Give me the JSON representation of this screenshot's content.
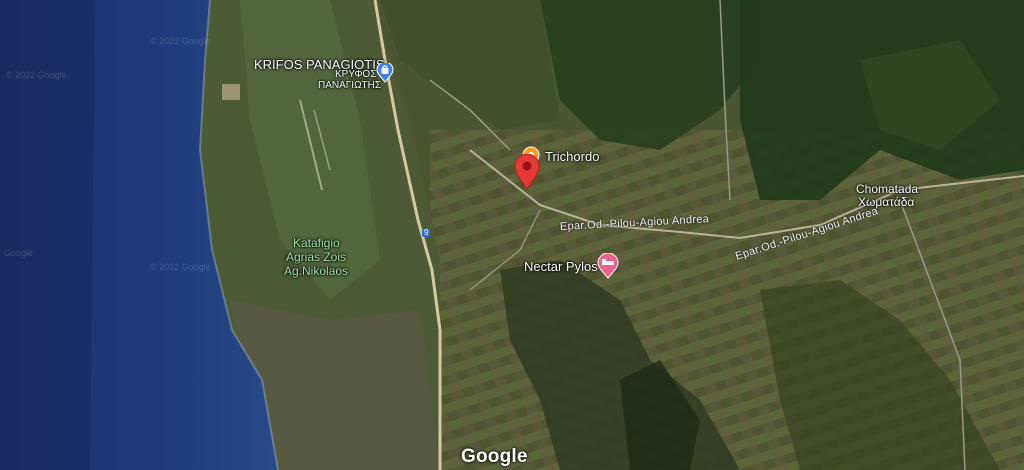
{
  "places": {
    "krifos_en": "KRIFOS PANAGIOTIS",
    "krifos_gr_1": "ΚΡΥΦΟΣ",
    "krifos_gr_2": "ΠΑΝΑΓΙΩΤΗΣ",
    "trichordo": "Trichordo",
    "chomatada_en": "Chomatada",
    "chomatada_gr": "Χωματάδα",
    "katafigio_1": "Katafigio",
    "katafigio_2": "Agrias Zois",
    "katafigio_3": "Ag.Nikolaos",
    "nectar": "Nectar Pylos"
  },
  "roads": {
    "label_1": "Epar.Od.-Pilou-Agiou Andrea",
    "label_2": "Epar.Od.-Pilou-Agiou Andrea",
    "route_shield": "9"
  },
  "watermarks": [
    "© 2022 Google",
    "© 2022 Google",
    "© 2022 Google",
    "Google"
  ],
  "branding": {
    "logo": "Google"
  },
  "icons": {
    "shopping": "shopping-bag-icon",
    "pin": "map-pin-icon",
    "hotel": "hotel-bed-icon",
    "food": "restaurant-icon"
  },
  "colors": {
    "sea": "#1f3a78",
    "land": "#4b5a33",
    "pin": "#e53935",
    "hotel": "#e8628f",
    "poi_blue": "#3f7ee8"
  }
}
